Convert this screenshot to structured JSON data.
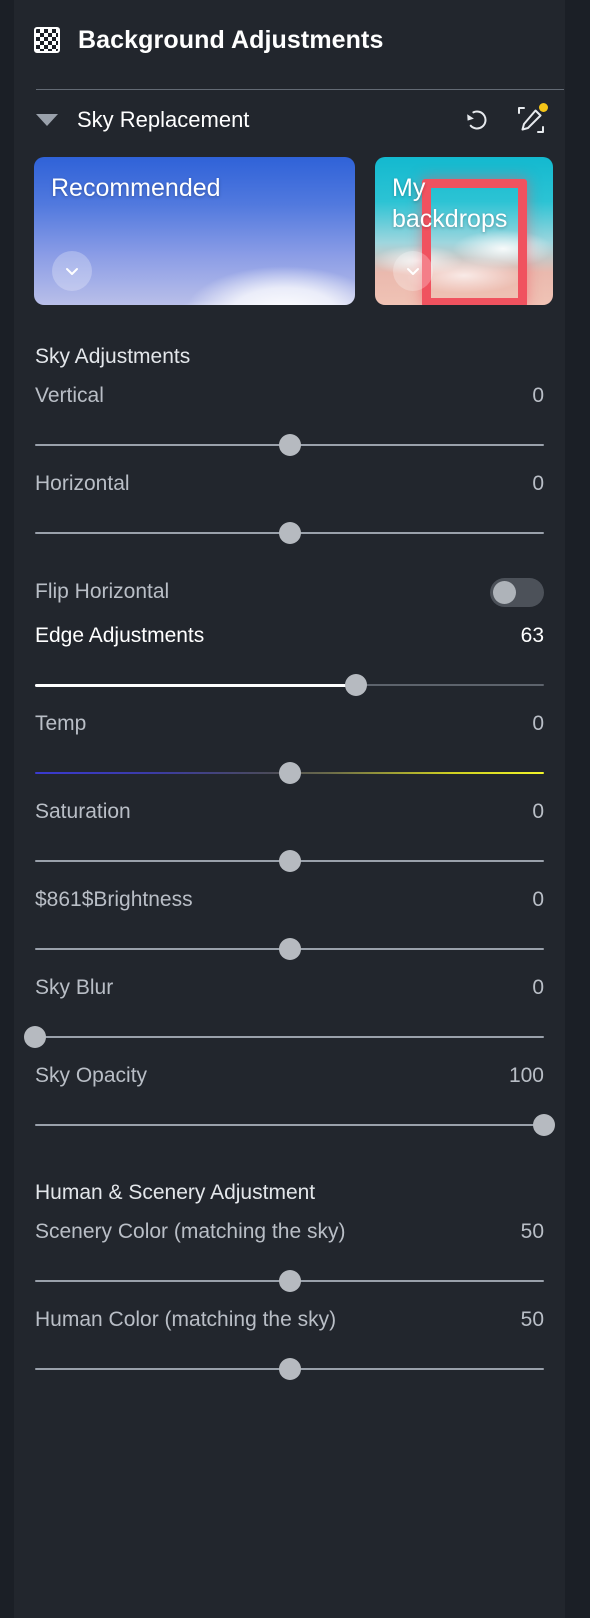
{
  "header": {
    "title": "Background Adjustments",
    "icon": "checkerboard-icon"
  },
  "section": {
    "title": "Sky Replacement",
    "caret": "caret-down-icon",
    "reset_icon": "reset-history-icon",
    "edit_icon": "edit-pencil-icon",
    "edit_badge_color": "#f5c518"
  },
  "presets": [
    {
      "label": "Recommended",
      "chevron": "chevron-down-icon"
    },
    {
      "label": "My backdrops",
      "chevron": "chevron-down-icon"
    }
  ],
  "groups": {
    "sky": "Sky Adjustments",
    "human_scenery": "Human & Scenery Adjustment"
  },
  "controls": {
    "vertical": {
      "label": "Vertical",
      "value": "0",
      "pos": 50
    },
    "horizontal": {
      "label": "Horizontal",
      "value": "0",
      "pos": 50
    },
    "flip": {
      "label": "Flip Horizontal",
      "state": "off"
    },
    "edge": {
      "label": "Edge Adjustments",
      "value": "63",
      "pos": 63
    },
    "temp": {
      "label": "Temp",
      "value": "0",
      "pos": 50
    },
    "saturation": {
      "label": "Saturation",
      "value": "0",
      "pos": 50
    },
    "brightness": {
      "label": "$861$Brightness",
      "value": "0",
      "pos": 50
    },
    "sky_blur": {
      "label": "Sky Blur",
      "value": "0",
      "pos": 0
    },
    "sky_opacity": {
      "label": "Sky Opacity",
      "value": "100",
      "pos": 100
    },
    "scenery_color": {
      "label": "Scenery Color (matching the sky)",
      "value": "50",
      "pos": 50
    },
    "human_color": {
      "label": "Human Color (matching the sky)",
      "value": "50",
      "pos": 50
    }
  }
}
